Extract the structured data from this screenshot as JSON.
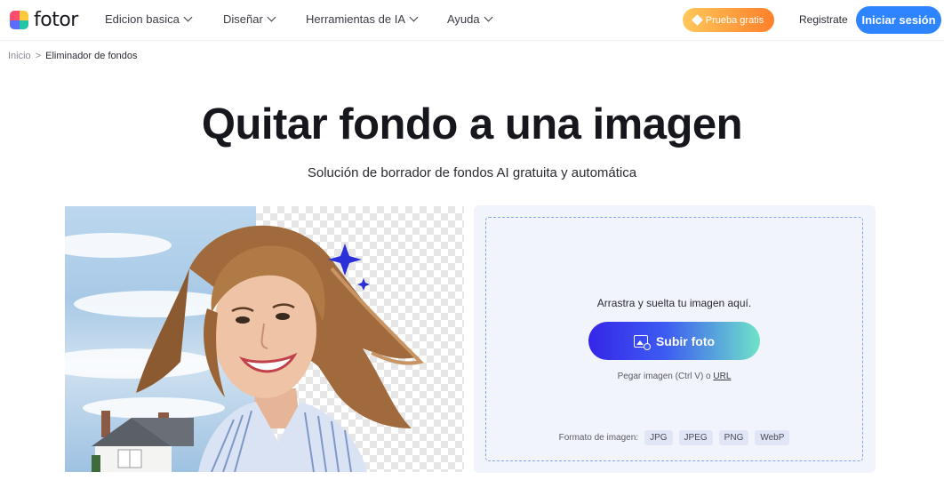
{
  "header": {
    "logo_text": "fotor",
    "nav": [
      {
        "label": "Edicion basica"
      },
      {
        "label": "Diseñar"
      },
      {
        "label": "Herramientas de IA"
      },
      {
        "label": "Ayuda"
      }
    ],
    "trial_label": "Prueba gratis",
    "register_label": "Registrate",
    "login_label": "Iniciar sesión"
  },
  "breadcrumb": {
    "home": "Inicio",
    "separator": ">",
    "current": "Eliminador de fondos"
  },
  "hero": {
    "title": "Quitar fondo a una imagen",
    "subtitle": "Solución de borrador de fondos AI gratuita y automática"
  },
  "upload": {
    "drop_text": "Arrastra y suelta tu imagen aquí.",
    "button_label": "Subir foto",
    "paste_prefix": "Pegar imagen (Ctrl V) o",
    "paste_link": "URL",
    "formats_label": "Formato de imagen:",
    "formats": [
      "JPG",
      "JPEG",
      "PNG",
      "WebP"
    ]
  },
  "colors": {
    "primary_blue": "#2e84ff",
    "trial_gradient_start": "#ffc85a",
    "trial_gradient_end": "#ff7f2a",
    "upload_gradient_start": "#3526e8",
    "upload_gradient_end": "#6fe3c8",
    "panel_bg": "#f2f4fb",
    "sparkle": "#2a2fd6"
  },
  "icons": {
    "trial": "diamond-icon",
    "upload": "image-add-icon",
    "nav_dropdown": "chevron-down-icon",
    "sparkle": "sparkle-icon"
  }
}
